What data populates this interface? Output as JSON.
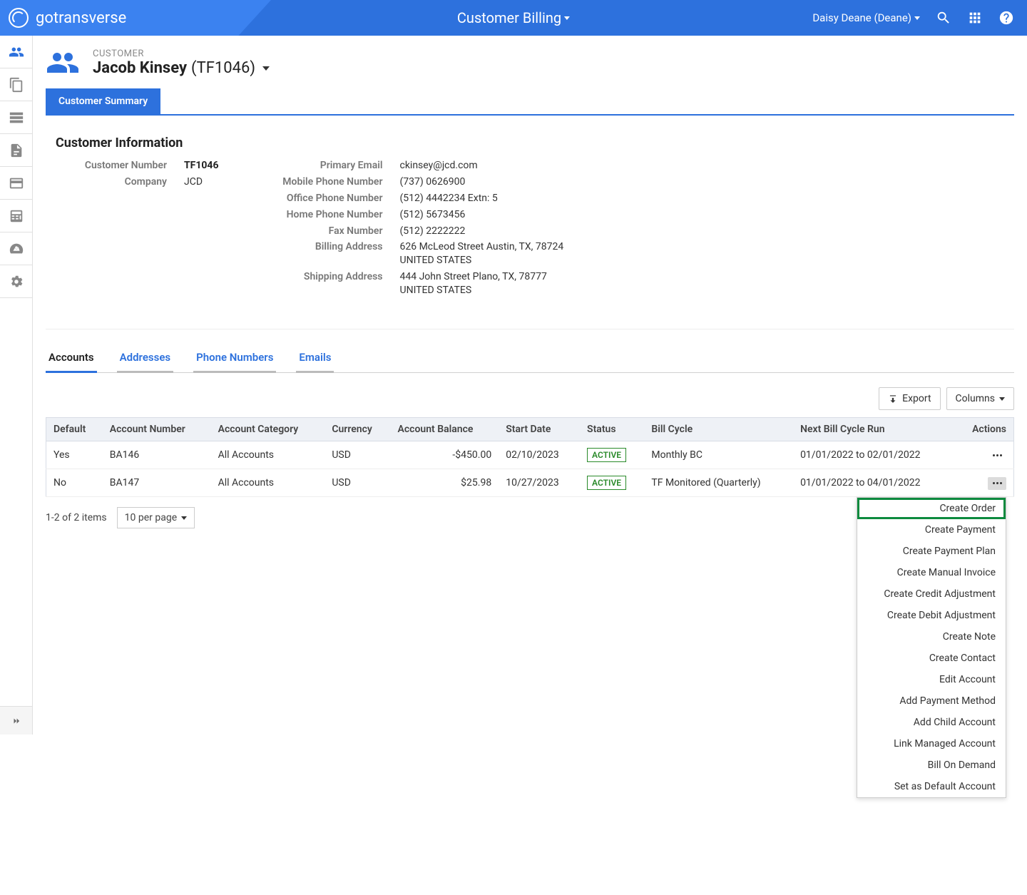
{
  "header": {
    "brand": "gotransverse",
    "title": "Customer Billing",
    "user": "Daisy Deane (Deane)"
  },
  "page": {
    "breadcrumb": "CUSTOMER",
    "name": "Jacob Kinsey",
    "code": "(TF1046)",
    "tab": "Customer Summary"
  },
  "info": {
    "title": "Customer Information",
    "left": [
      {
        "label": "Customer Number",
        "value": "TF1046",
        "bold": true
      },
      {
        "label": "Company",
        "value": "JCD"
      }
    ],
    "right": [
      {
        "label": "Primary Email",
        "value": "ckinsey@jcd.com"
      },
      {
        "label": "Mobile Phone Number",
        "value": "(737) 0626900"
      },
      {
        "label": "Office Phone Number",
        "value": "(512) 4442234 Extn: 5"
      },
      {
        "label": "Home Phone Number",
        "value": "(512) 5673456"
      },
      {
        "label": "Fax Number",
        "value": "(512) 2222222"
      },
      {
        "label": "Billing Address",
        "value": "626 McLeod Street Austin, TX, 78724 UNITED STATES"
      },
      {
        "label": "Shipping Address",
        "value": "444 John Street Plano, TX, 78777 UNITED STATES"
      }
    ]
  },
  "subtabs": [
    "Accounts",
    "Addresses",
    "Phone Numbers",
    "Emails"
  ],
  "toolbar": {
    "export": "Export",
    "columns": "Columns"
  },
  "table": {
    "headers": [
      "Default",
      "Account Number",
      "Account Category",
      "Currency",
      "Account Balance",
      "Start Date",
      "Status",
      "Bill Cycle",
      "Next Bill Cycle Run",
      "Actions"
    ],
    "rows": [
      {
        "default": "Yes",
        "acct": "BA146",
        "cat": "All Accounts",
        "cur": "USD",
        "bal": "-$450.00",
        "start": "02/10/2023",
        "status": "ACTIVE",
        "cycle": "Monthly BC",
        "next": "01/01/2022 to 02/01/2022"
      },
      {
        "default": "No",
        "acct": "BA147",
        "cat": "All Accounts",
        "cur": "USD",
        "bal": "$25.98",
        "start": "10/27/2023",
        "status": "ACTIVE",
        "cycle": "TF Monitored (Quarterly)",
        "next": "01/01/2022 to 04/01/2022"
      }
    ]
  },
  "pager": {
    "summary": "1-2 of 2 items",
    "perpage": "10 per page"
  },
  "actions_menu": [
    "Create Order",
    "Create Payment",
    "Create Payment Plan",
    "Create Manual Invoice",
    "Create Credit Adjustment",
    "Create Debit Adjustment",
    "Create Note",
    "Create Contact",
    "Edit Account",
    "Add Payment Method",
    "Add Child Account",
    "Link Managed Account",
    "Bill On Demand",
    "Set as Default Account"
  ]
}
